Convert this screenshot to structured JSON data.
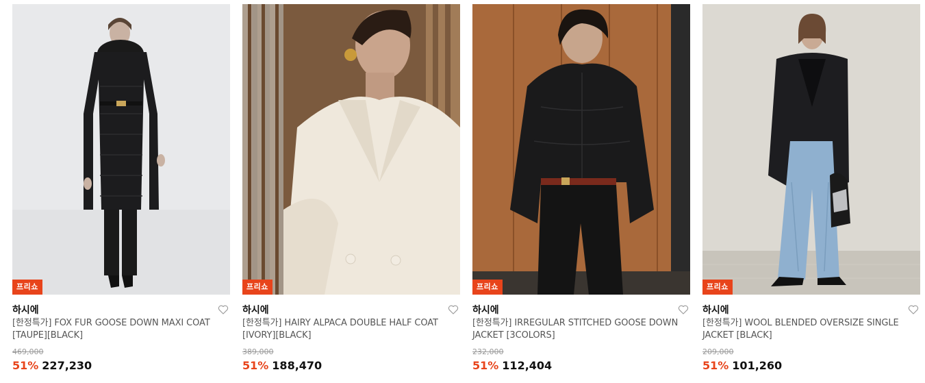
{
  "products": [
    {
      "badge": "프리쇼",
      "brand": "하시에",
      "title": "[한정특가] FOX FUR GOOSE DOWN MAXI COAT [TAUPE][BLACK]",
      "original_price": "469,000",
      "discount": "51%",
      "price": "227,230",
      "image": "black-long-puffer-coat-photo",
      "bg": "#e6e7e9"
    },
    {
      "badge": "프리쇼",
      "brand": "하시에",
      "title": "[한정특가] HAIRY ALPACA DOUBLE HALF COAT [IVORY][BLACK]",
      "original_price": "389,000",
      "discount": "51%",
      "price": "188,470",
      "image": "ivory-alpaca-coat-photo",
      "bg": "#8a6a4a"
    },
    {
      "badge": "프리쇼",
      "brand": "하시에",
      "title": "[한정특가] IRREGULAR STITCHED GOOSE DOWN JACKET [3COLORS]",
      "original_price": "232,000",
      "discount": "51%",
      "price": "112,404",
      "image": "black-down-jacket-photo",
      "bg": "#a8683a"
    },
    {
      "badge": "프리쇼",
      "brand": "하시에",
      "title": "[한정특가] WOOL BLENDED OVERSIZE SINGLE JACKET [BLACK]",
      "original_price": "209,000",
      "discount": "51%",
      "price": "101,260",
      "image": "black-oversize-jacket-photo",
      "bg": "#d9d6cf"
    }
  ],
  "colors": {
    "accent": "#e8441b",
    "muted": "#999999"
  }
}
